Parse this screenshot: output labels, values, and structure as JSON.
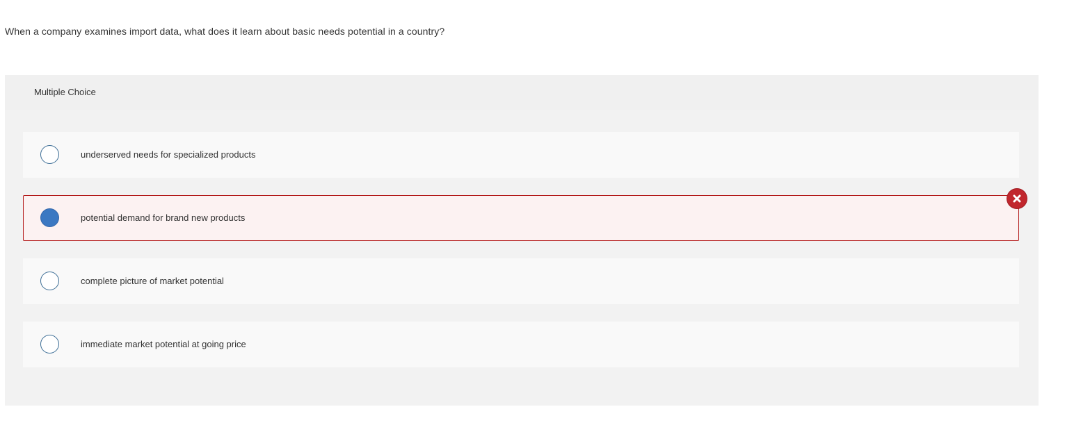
{
  "question": {
    "text": "When a company examines import data, what does it learn about basic needs potential in a country?"
  },
  "panel": {
    "header_label": "Multiple Choice"
  },
  "choices": [
    {
      "label": "underserved needs for specialized products",
      "selected": false,
      "status": ""
    },
    {
      "label": "potential demand for brand new products",
      "selected": true,
      "status": "incorrect"
    },
    {
      "label": "complete picture of market potential",
      "selected": false,
      "status": ""
    },
    {
      "label": "immediate market potential at going price",
      "selected": false,
      "status": ""
    }
  ],
  "icons": {
    "result": "close-circle-icon"
  },
  "colors": {
    "incorrect": "#c1272d",
    "selected_radio": "#3b78c2",
    "radio_border": "#3d6e96"
  }
}
